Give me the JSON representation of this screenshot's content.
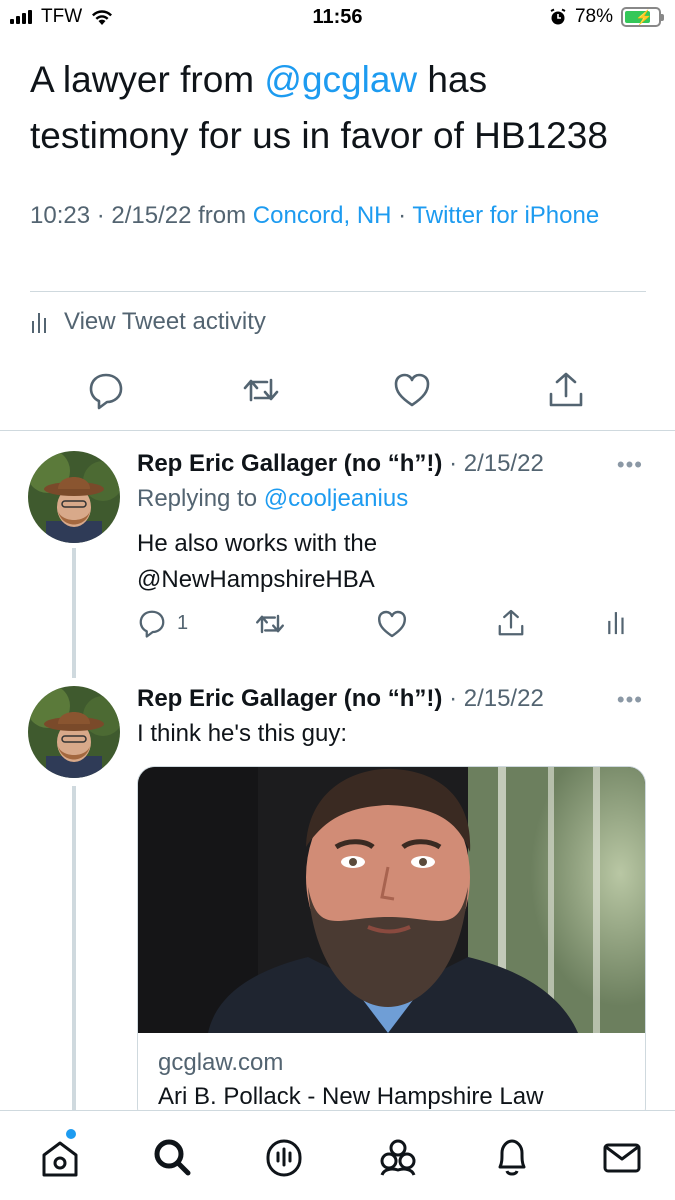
{
  "status_bar": {
    "carrier": "TFW",
    "time": "11:56",
    "battery": "78%",
    "battery_level": 0.78
  },
  "main_tweet": {
    "text_before": "A lawyer from ",
    "mention": "@gcglaw",
    "text_after": " has testimony for us in favor of HB1238",
    "timestamp": "10:23 · 2/15/22 from ",
    "location": "Concord, NH",
    "separator": " · ",
    "source": "Twitter for iPhone",
    "activity_label": "View Tweet activity"
  },
  "replies": [
    {
      "author": "Rep Eric Gallager (no “h”!)",
      "date": "· 2/15/22",
      "replying_prefix": "Replying to ",
      "replying_to": "@cooljeanius",
      "text_line1": "He also works with the",
      "text_mention": "@NewHampshireHBA",
      "reply_count": "1"
    },
    {
      "author": "Rep Eric Gallager (no “h”!)",
      "date": "· 2/15/22",
      "text": "I think he's this guy:",
      "card": {
        "domain": "gcglaw.com",
        "title": "Ari B. Pollack - New Hampshire Law"
      }
    }
  ],
  "more_glyph": "•••",
  "colors": {
    "accent": "#1d9bf0",
    "text": "#0f1419",
    "secondary": "#536471",
    "border": "#cfd9de"
  },
  "icons": [
    "reply-icon",
    "retweet-icon",
    "like-icon",
    "share-icon",
    "analytics-icon",
    "home-icon",
    "search-icon",
    "spaces-icon",
    "communities-icon",
    "notifications-icon",
    "messages-icon"
  ]
}
